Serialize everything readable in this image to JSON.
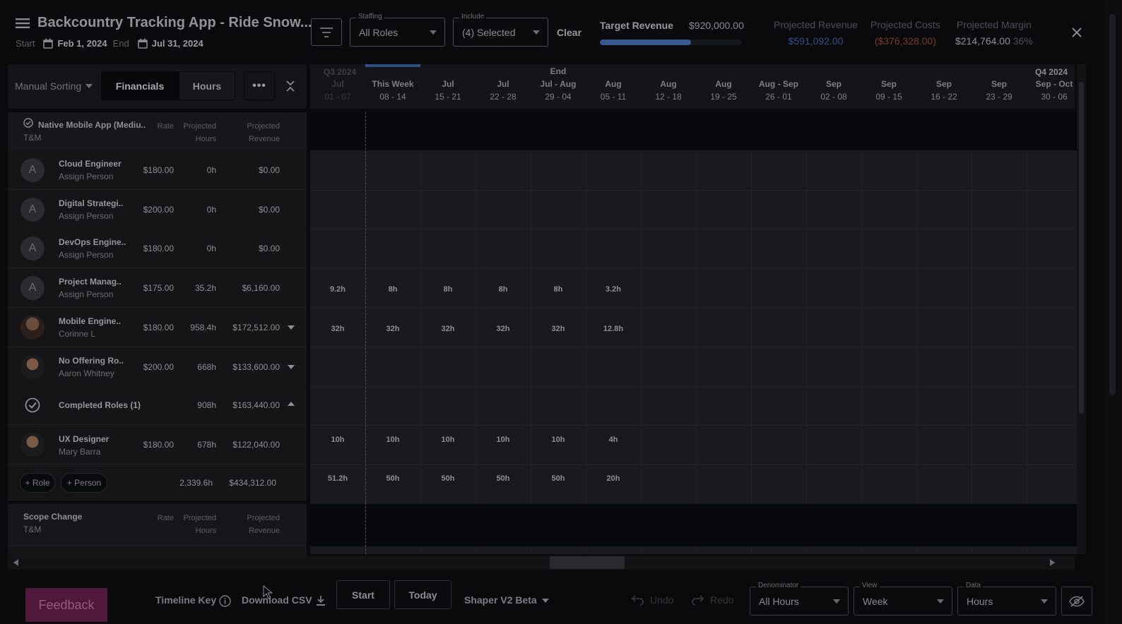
{
  "header": {
    "title": "Backcountry Tracking App - Ride Snow...",
    "start_label": "Start",
    "start_date": "Feb 1, 2024",
    "end_label": "End",
    "end_date": "Jul 31, 2024",
    "staffing": {
      "label": "Staffing",
      "value": "All Roles"
    },
    "include": {
      "label": "Include",
      "value": "(4) Selected"
    },
    "clear_label": "Clear",
    "target_revenue_label": "Target Revenue",
    "target_revenue_value": "$920,000.00",
    "target_revenue_progress": 0.64,
    "projected_revenue_label": "Projected Revenue",
    "projected_revenue_value": "$591,092.00",
    "projected_costs_label": "Projected Costs",
    "projected_costs_value": "($376,328.00)",
    "projected_margin_label": "Projected Margin",
    "projected_margin_value": "$214,764.00",
    "projected_margin_pct": "36%"
  },
  "toolbar": {
    "sort_label": "Manual Sorting",
    "tab_financials": "Financials",
    "tab_hours": "Hours",
    "more_label": "•••"
  },
  "timeline": {
    "quarter_left": "Q3 2024",
    "quarter_right": "Q4 2024",
    "end_marker": "End",
    "weeks": [
      {
        "month": "Jul",
        "range": "01 - 07"
      },
      {
        "month": "This Week",
        "range": "08 - 14"
      },
      {
        "month": "Jul",
        "range": "15 - 21"
      },
      {
        "month": "Jul",
        "range": "22 - 28"
      },
      {
        "month": "Jul - Aug",
        "range": "29 - 04"
      },
      {
        "month": "Aug",
        "range": "05 - 11"
      },
      {
        "month": "Aug",
        "range": "12 - 18"
      },
      {
        "month": "Aug",
        "range": "19 - 25"
      },
      {
        "month": "Aug - Sep",
        "range": "26 - 01"
      },
      {
        "month": "Sep",
        "range": "02 - 08"
      },
      {
        "month": "Sep",
        "range": "09 - 15"
      },
      {
        "month": "Sep",
        "range": "16 - 22"
      },
      {
        "month": "Sep",
        "range": "23 - 29"
      },
      {
        "month": "Sep - Oct",
        "range": "30 - 06"
      }
    ]
  },
  "group1": {
    "name": "Native Mobile App (Mediu..",
    "type": "T&M",
    "col_rate": "Rate",
    "col_hours_1": "Projected",
    "col_hours_2": "Hours",
    "col_rev_1": "Projected",
    "col_rev_2": "Revenue"
  },
  "rows": [
    {
      "avatar": "A",
      "role": "Cloud Engineer",
      "person": "Assign Person",
      "rate": "$180.00",
      "hours": "0h",
      "revenue": "$0.00",
      "weeks": []
    },
    {
      "avatar": "A",
      "role": "Digital Strategi..",
      "person": "Assign Person",
      "rate": "$200.00",
      "hours": "0h",
      "revenue": "$0.00",
      "weeks": []
    },
    {
      "avatar": "A",
      "role": "DevOps Engine..",
      "person": "Assign Person",
      "rate": "$180.00",
      "hours": "0h",
      "revenue": "$0.00",
      "weeks": []
    },
    {
      "avatar": "A",
      "role": "Project Manag..",
      "person": "Assign Person",
      "rate": "$175.00",
      "hours": "35.2h",
      "revenue": "$6,160.00",
      "weeks": [
        "9.2h",
        "8h",
        "8h",
        "8h",
        "8h",
        "3.2h"
      ]
    },
    {
      "avatar": "",
      "role": "Mobile Engine..",
      "person": "Corinne L",
      "rate": "$180.00",
      "hours": "958.4h",
      "revenue": "$172,512.00",
      "weeks": [
        "32h",
        "32h",
        "32h",
        "32h",
        "32h",
        "12.8h"
      ]
    },
    {
      "avatar": "",
      "role": "No Offering Ro..",
      "person": "Aaron Whitney",
      "rate": "$200.00",
      "hours": "668h",
      "revenue": "$133,600.00",
      "weeks": []
    }
  ],
  "completed": {
    "label": "Completed Roles (1)",
    "hours": "908h",
    "revenue": "$163,440.00"
  },
  "completed_rows": [
    {
      "role": "UX Designer",
      "person": "Mary Barra",
      "rate": "$180.00",
      "hours": "678h",
      "revenue": "$122,040.00",
      "weeks": [
        "10h",
        "10h",
        "10h",
        "10h",
        "10h",
        "4h"
      ]
    }
  ],
  "group1_totals": {
    "add_role": "+ Role",
    "add_person": "+ Person",
    "hours": "2,339.6h",
    "revenue": "$434,312.00",
    "weeks": [
      "51.2h",
      "50h",
      "50h",
      "50h",
      "50h",
      "20h"
    ]
  },
  "group2": {
    "name": "Scope Change",
    "type": "T&M",
    "col_rate": "Rate",
    "col_hours_1": "Projected",
    "col_hours_2": "Hours",
    "col_rev_1": "Projected",
    "col_rev_2": "Revenue"
  },
  "footer": {
    "feedback": "Feedback",
    "timeline_key": "Timeline Key",
    "download_csv": "Download CSV",
    "start_btn": "Start",
    "today_btn": "Today",
    "shaper": "Shaper V2 Beta",
    "undo": "Undo",
    "redo": "Redo",
    "denominator": {
      "label": "Denominator",
      "value": "All Hours"
    },
    "view": {
      "label": "View",
      "value": "Week"
    },
    "data": {
      "label": "Data",
      "value": "Hours"
    }
  },
  "colors": {
    "accent": "#37598f",
    "cost": "#7a3a22",
    "revenue": "#2f4f8a"
  }
}
